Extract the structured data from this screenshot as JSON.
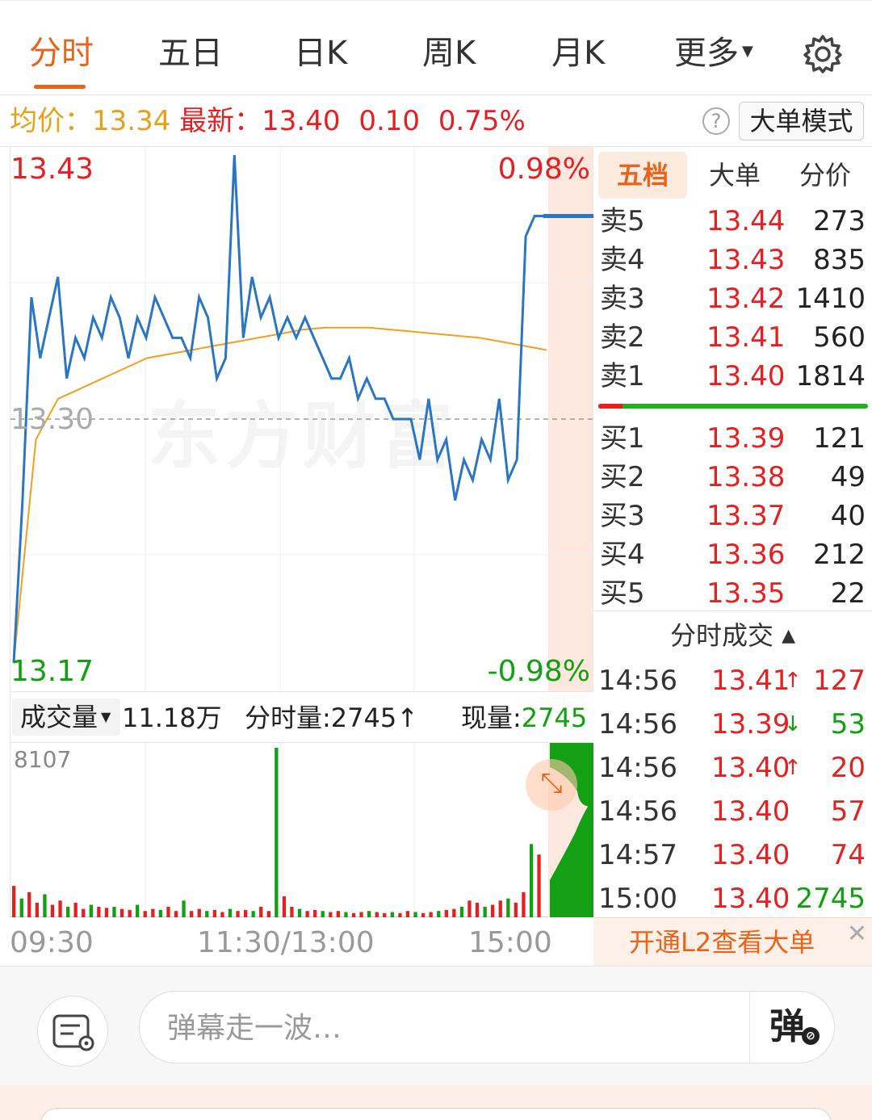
{
  "tabs": [
    {
      "label": "分时",
      "active": true
    },
    {
      "label": "五日"
    },
    {
      "label": "日K"
    },
    {
      "label": "周K"
    },
    {
      "label": "月K"
    },
    {
      "label": "更多"
    }
  ],
  "info": {
    "avg_label": "均价：",
    "avg_value": "13.34",
    "latest_label": "最新：",
    "latest_value": "13.40",
    "change": "0.10",
    "change_pct": "0.75%",
    "help": "?",
    "mode_button": "大单模式"
  },
  "chart": {
    "price_high": "13.43",
    "price_low": "13.17",
    "price_mid": "13.30",
    "pct_high": "0.98%",
    "pct_low": "-0.98%",
    "watermark": "东方财富"
  },
  "chart_data": {
    "type": "line",
    "ylim": [
      13.17,
      13.43
    ],
    "base_price": 13.3,
    "series": [
      {
        "values": [
          13.18,
          13.26,
          13.36,
          13.33,
          13.35,
          13.37,
          13.32,
          13.34,
          13.33,
          13.35,
          13.34,
          13.36,
          13.35,
          13.33,
          13.35,
          13.34,
          13.36,
          13.35,
          13.34,
          13.34,
          13.33,
          13.36,
          13.35,
          13.32,
          13.33,
          13.43,
          13.34,
          13.37,
          13.35,
          13.36,
          13.34,
          13.35,
          13.34,
          13.35,
          13.34,
          13.33,
          13.32,
          13.32,
          13.33,
          13.31,
          13.32,
          13.31,
          13.31,
          13.3,
          13.3,
          13.3,
          13.28,
          13.31,
          13.28,
          13.29,
          13.26,
          13.28,
          13.27,
          13.29,
          13.28,
          13.31,
          13.27,
          13.28,
          13.39,
          13.4,
          13.4
        ]
      },
      {
        "values": [
          13.18,
          13.29,
          13.31,
          13.315,
          13.32,
          13.325,
          13.33,
          13.332,
          13.334,
          13.336,
          13.338,
          13.34,
          13.342,
          13.344,
          13.345,
          13.345,
          13.345,
          13.344,
          13.343,
          13.342,
          13.341,
          13.34,
          13.338,
          13.336,
          13.334
        ]
      }
    ]
  },
  "volume": {
    "selector": "成交量",
    "total": "11.18万",
    "period_label": "分时量:",
    "period_value": "2745",
    "period_arrow": "↑",
    "current_label": "现量:",
    "current_value": "2745",
    "max_label": "8107",
    "expand": "⤡"
  },
  "volume_data": {
    "values": [
      1500,
      900,
      1200,
      700,
      1100,
      600,
      800,
      500,
      700,
      400,
      600,
      500,
      450,
      500,
      400,
      350,
      600,
      300,
      400,
      350,
      500,
      300,
      800,
      300,
      400,
      300,
      350,
      250,
      400,
      300,
      350,
      300,
      500,
      300,
      8107,
      1000,
      500,
      400,
      300,
      350,
      300,
      250,
      300,
      250,
      200,
      250,
      300,
      250,
      200,
      250,
      200,
      300,
      250,
      200,
      250,
      300,
      350,
      400,
      500,
      800,
      700,
      500,
      600,
      800,
      900,
      700,
      1200,
      3500,
      3000
    ]
  },
  "time_axis": [
    "09:30",
    "11:30/13:00",
    "15:00"
  ],
  "right_tabs": [
    {
      "label": "五档",
      "active": true
    },
    {
      "label": "大单"
    },
    {
      "label": "分价"
    }
  ],
  "asks": [
    {
      "label": "卖5",
      "price": "13.44",
      "vol": "273"
    },
    {
      "label": "卖4",
      "price": "13.43",
      "vol": "835"
    },
    {
      "label": "卖3",
      "price": "13.42",
      "vol": "1410"
    },
    {
      "label": "卖2",
      "price": "13.41",
      "vol": "560"
    },
    {
      "label": "卖1",
      "price": "13.40",
      "vol": "1814"
    }
  ],
  "bids": [
    {
      "label": "买1",
      "price": "13.39",
      "vol": "121"
    },
    {
      "label": "买2",
      "price": "13.38",
      "vol": "49"
    },
    {
      "label": "买3",
      "price": "13.37",
      "vol": "40"
    },
    {
      "label": "买4",
      "price": "13.36",
      "vol": "212"
    },
    {
      "label": "买5",
      "price": "13.35",
      "vol": "22"
    }
  ],
  "ticks_title": "分时成交",
  "ticks": [
    {
      "time": "14:56",
      "price": "13.41",
      "arrow": "↑",
      "vol": "127",
      "dir": "up"
    },
    {
      "time": "14:56",
      "price": "13.39",
      "arrow": "↓",
      "vol": "53",
      "dir": "down"
    },
    {
      "time": "14:56",
      "price": "13.40",
      "arrow": "↑",
      "vol": "20",
      "dir": "up"
    },
    {
      "time": "14:56",
      "price": "13.40",
      "arrow": "",
      "vol": "57",
      "dir": "up"
    },
    {
      "time": "14:57",
      "price": "13.40",
      "arrow": "",
      "vol": "74",
      "dir": "up"
    },
    {
      "time": "15:00",
      "price": "13.40",
      "arrow": "",
      "vol": "2745",
      "dir": "down"
    }
  ],
  "l2_banner": "开通L2查看大单",
  "danmu": {
    "placeholder": "弹幕走一波…",
    "toggle": "弹"
  },
  "colors": {
    "accent": "#e8641b",
    "up": "#e52020",
    "down": "#10a010",
    "price_line": "#2a76c2",
    "avg_line": "#f0a020"
  }
}
